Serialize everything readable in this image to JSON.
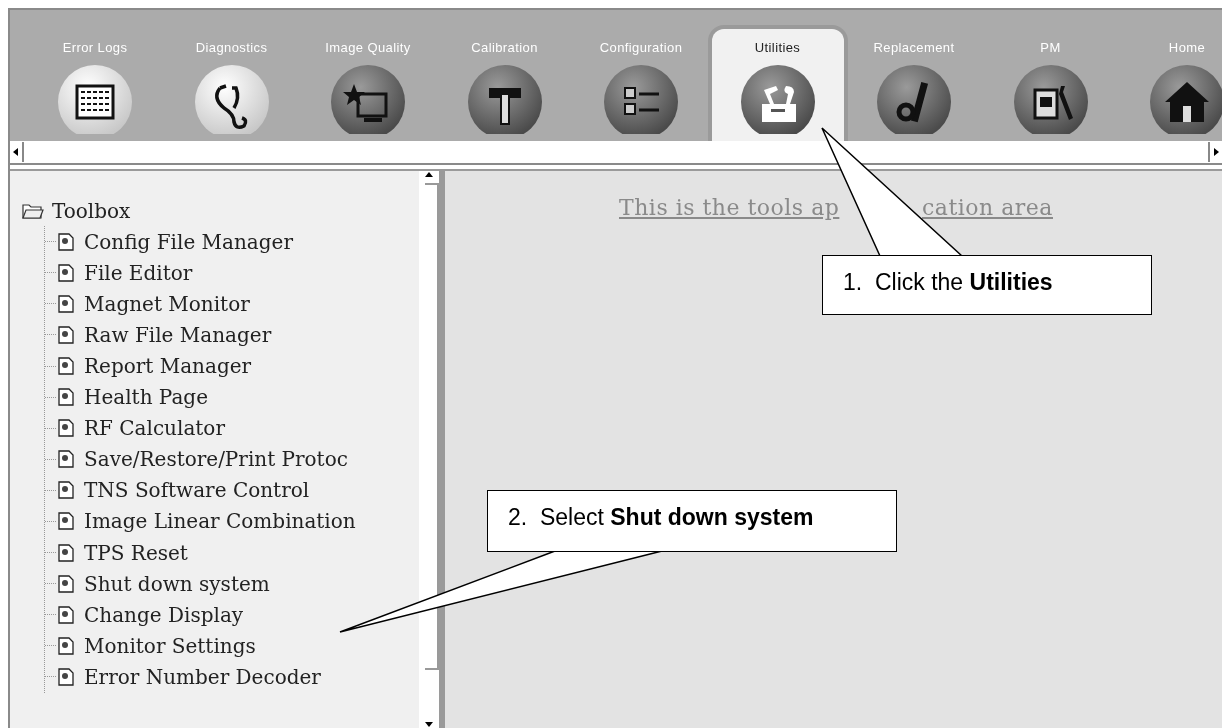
{
  "tabs": [
    {
      "label": "Error Logs",
      "selected": false
    },
    {
      "label": "Diagnostics",
      "selected": false
    },
    {
      "label": "Image Quality",
      "selected": false
    },
    {
      "label": "Calibration",
      "selected": false
    },
    {
      "label": "Configuration",
      "selected": false
    },
    {
      "label": "Utilities",
      "selected": true
    },
    {
      "label": "Replacement",
      "selected": false
    },
    {
      "label": "PM",
      "selected": false
    },
    {
      "label": "Home",
      "selected": false
    }
  ],
  "tree": {
    "label": "Toolbox",
    "expanded": true,
    "children": [
      {
        "label": "Config File Manager"
      },
      {
        "label": "File Editor"
      },
      {
        "label": "Magnet Monitor"
      },
      {
        "label": "Raw File Manager"
      },
      {
        "label": "Report Manager"
      },
      {
        "label": "Health Page"
      },
      {
        "label": "RF Calculator"
      },
      {
        "label": "Save/Restore/Print Protoc"
      },
      {
        "label": "TNS Software Control"
      },
      {
        "label": "Image Linear Combination"
      },
      {
        "label": "TPS Reset"
      },
      {
        "label": "Shut down system"
      },
      {
        "label": "Change Display"
      },
      {
        "label": "Monitor Settings"
      },
      {
        "label": "Error Number Decoder"
      }
    ]
  },
  "content_area": {
    "text_before_callout": "This is the tools ap",
    "text_after_callout": "cation area"
  },
  "callouts": [
    {
      "text": "1.  Click the **Utilities**"
    },
    {
      "text": "2.  Select **Shut down system**"
    }
  ]
}
